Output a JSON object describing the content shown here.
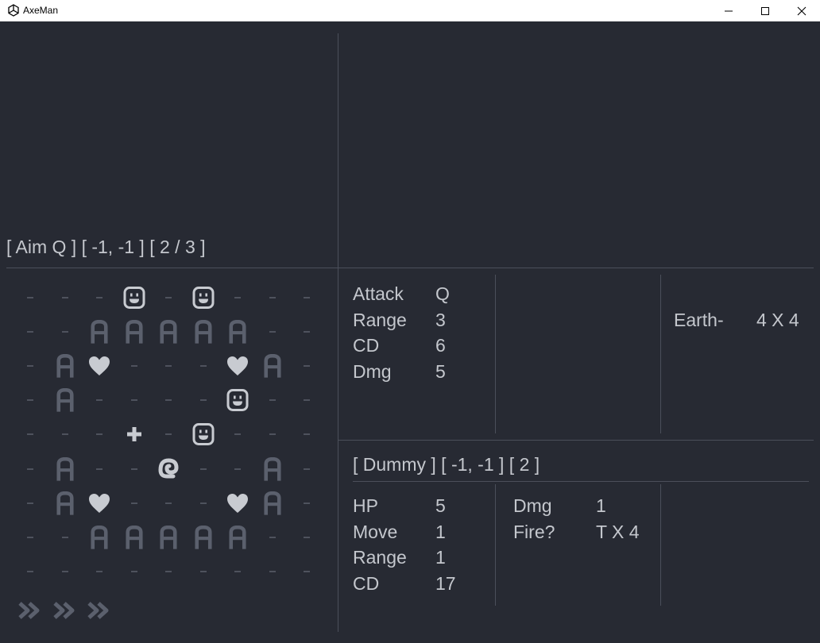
{
  "window": {
    "title": "AxeMan",
    "controls": {
      "minimize": "minimize-icon",
      "maximize": "maximize-icon",
      "close": "close-icon"
    }
  },
  "status_line": {
    "text": "[ Aim Q ] [ -1, -1 ] [ 2 / 3 ]"
  },
  "skill": {
    "rows": [
      {
        "label": "Attack",
        "value": "Q"
      },
      {
        "label": "Range",
        "value": "3"
      },
      {
        "label": "CD",
        "value": "6"
      },
      {
        "label": "Dmg",
        "value": "5"
      }
    ]
  },
  "effect": {
    "label": "Earth-",
    "value": "4 X 4"
  },
  "target": {
    "header": "[ Dummy ] [ -1, -1 ] [ 2 ]",
    "stats_left": [
      {
        "label": "HP",
        "value": "5"
      },
      {
        "label": "Move",
        "value": "1"
      },
      {
        "label": "Range",
        "value": "1"
      },
      {
        "label": "CD",
        "value": "17"
      }
    ],
    "stats_right": [
      {
        "label": "Dmg",
        "value": "1"
      },
      {
        "label": "Fire?",
        "value": "T X 4"
      }
    ]
  },
  "map": {
    "rows": [
      "---F-F---",
      "--AAAAA--",
      "-AH---HA-",
      "-A----F--",
      "---P-F---",
      "-A--@--A-",
      "-AH---HA-",
      "--AAAAA--",
      "---------"
    ],
    "legend": {
      "-": "floor",
      "A": "wall",
      "H": "heart",
      "F": "face",
      "P": "plus",
      "@": "player"
    }
  },
  "action_queue": {
    "icons": [
      "chevron-right-icon",
      "chevron-right-icon",
      "chevron-right-icon"
    ]
  },
  "colors": {
    "background": "#272a33",
    "text": "#c4c7cd",
    "divider": "#4b4f5a",
    "wall": "#5b606d",
    "floor": "#4e525d",
    "actor": "#c8cbd1"
  }
}
